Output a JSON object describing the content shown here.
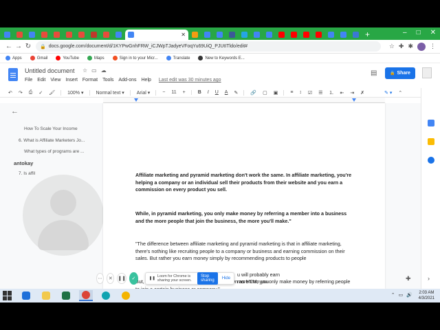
{
  "browser": {
    "url": "docs.google.com/document/d/1KYPwGnhFRW_iCJWpTJadyeVFoqYu69UiQ_PJUtITldo/edit#",
    "tab_colors": [
      "#4285f4",
      "#e74c3c",
      "#4285f4",
      "#e74c3c",
      "#e74c3c",
      "#e74c3c",
      "#e74c3c",
      "#c0392b",
      "#e74c3c",
      "#4285f4",
      "#4285f4",
      "#f39c12",
      "#4285f4",
      "#4285f4",
      "#3b5998",
      "#26a5e4",
      "#4285f4",
      "#4285f4",
      "#ff0000",
      "#ff0000",
      "#ff0000",
      "#ff0000",
      "#4285f4",
      "#4285f4",
      "#3b78d4"
    ],
    "window_controls": [
      "–",
      "□",
      "✕"
    ],
    "new_tab": "+",
    "bookmarks": [
      {
        "label": "Apps",
        "color": "#4285f4"
      },
      {
        "label": "Gmail",
        "color": "#ea4335"
      },
      {
        "label": "YouTube",
        "color": "#ff0000"
      },
      {
        "label": "Maps",
        "color": "#34a853"
      },
      {
        "label": "Sign in to your Micr...",
        "color": "#f25022"
      },
      {
        "label": "Translate",
        "color": "#4285f4"
      },
      {
        "label": "New to Keywords E...",
        "color": "#333333"
      }
    ]
  },
  "docs": {
    "title": "Untitled document",
    "menu": [
      "File",
      "Edit",
      "View",
      "Insert",
      "Format",
      "Tools",
      "Add-ons",
      "Help"
    ],
    "last_edit": "Last edit was 30 minutes ago",
    "share_label": "Share",
    "toolbar": {
      "zoom": "100%",
      "style": "Normal text",
      "font": "Arial",
      "font_size": "11",
      "bold": "B",
      "italic": "I",
      "underline": "U",
      "text_color": "A"
    }
  },
  "outline": {
    "items": [
      {
        "label": "How To Scale Your Income",
        "bold": false
      },
      {
        "label": "6. What is Affiliate Marketers Jo...",
        "bold": false
      },
      {
        "label": "What types of programs are ...",
        "bold": false
      },
      {
        "label": "antokay",
        "bold": true
      },
      {
        "label": "7. Is affil",
        "bold": false
      }
    ]
  },
  "document": {
    "paragraphs": [
      {
        "text": "Affiliate marketing and pyramid marketing don't work the same. In affiliate marketing, you're helping a company or an individual sell their products from their website and you earn a commission on every product you sell.",
        "bold": true
      },
      {
        "text": "While, in pyramid marketing, you only make money by referring a member into a business and the more people that join the business, the more you'll make.\"",
        "bold": true
      },
      {
        "text": "\"The difference between affiliate marketing and pyramid marketing is that in affiliate marketing, there's nothing like recruiting people to a company or business and earning commission on their sales. But rather you earn money simply by recommending products to people",
        "bold": false
      },
      {
        "text": "But, in pyramid marketing, which is also known as MLM, you only make money by referring people to join a certain business or company.\"",
        "bold": false
      },
      {
        "text": "u will probably earn more than you",
        "bold": false
      }
    ]
  },
  "loom": {
    "notice": "Loom for Chrome is sharing your screen.",
    "stop_label": "Stop sharing",
    "hide_label": "Hide"
  },
  "taskbar": {
    "time": "2:03 AM",
    "date": "4/3/2021",
    "apps": [
      {
        "name": "edge-legacy",
        "color": "#1e6fd9"
      },
      {
        "name": "file-explorer",
        "color": "#f2c94c"
      },
      {
        "name": "excel",
        "color": "#1e7145"
      },
      {
        "name": "chrome",
        "color": "#db4437"
      },
      {
        "name": "edge",
        "color": "#0fa3b1"
      },
      {
        "name": "chrome-2",
        "color": "#f4b400"
      }
    ]
  }
}
